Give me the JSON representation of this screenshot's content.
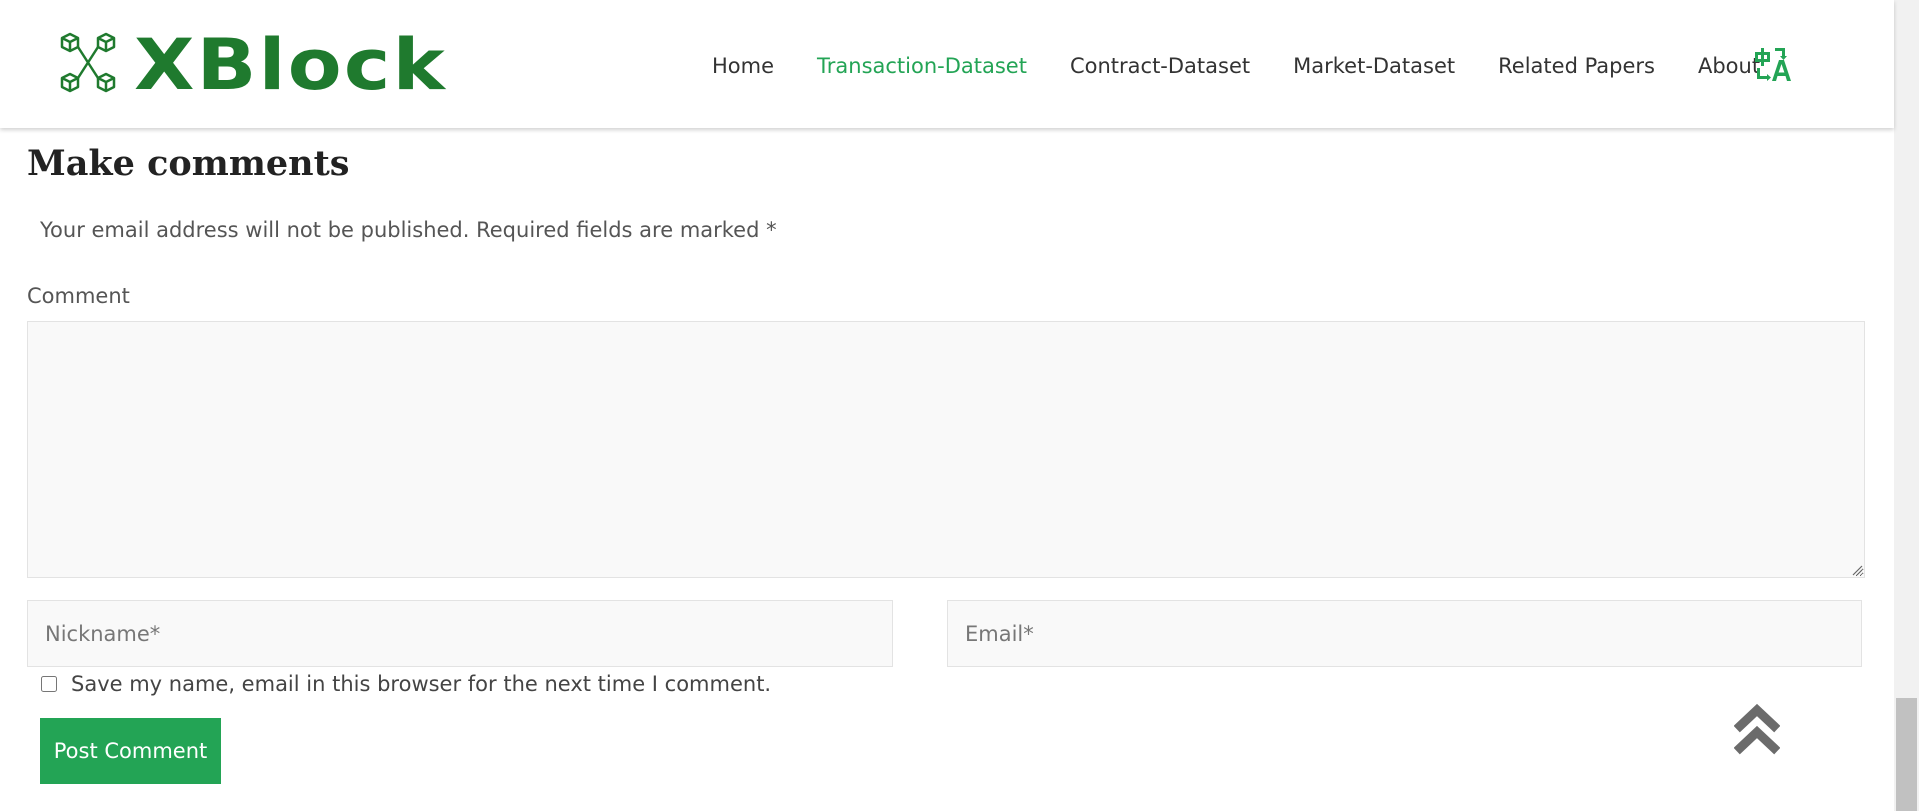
{
  "header": {
    "logo_text": "XBlock",
    "nav": [
      {
        "label": "Home",
        "active": false
      },
      {
        "label": "Transaction-Dataset",
        "active": true
      },
      {
        "label": "Contract-Dataset",
        "active": false
      },
      {
        "label": "Market-Dataset",
        "active": false
      },
      {
        "label": "Related Papers",
        "active": false
      },
      {
        "label": "About",
        "active": false
      }
    ],
    "language_icon": "translate-icon"
  },
  "comments": {
    "title": "Make comments",
    "notice": "Your email address will not be published. Required fields are marked *",
    "comment_label": "Comment",
    "comment_value": "",
    "nickname_placeholder": "Nickname*",
    "email_placeholder": "Email*",
    "save_label": "Save my name, email in this browser for the next time I comment.",
    "submit_label": "Post Comment"
  },
  "colors": {
    "brand_green": "#1f7a2e",
    "accent_green": "#23a455"
  },
  "icons": {
    "scroll_top": "double-chevron-up-icon"
  }
}
